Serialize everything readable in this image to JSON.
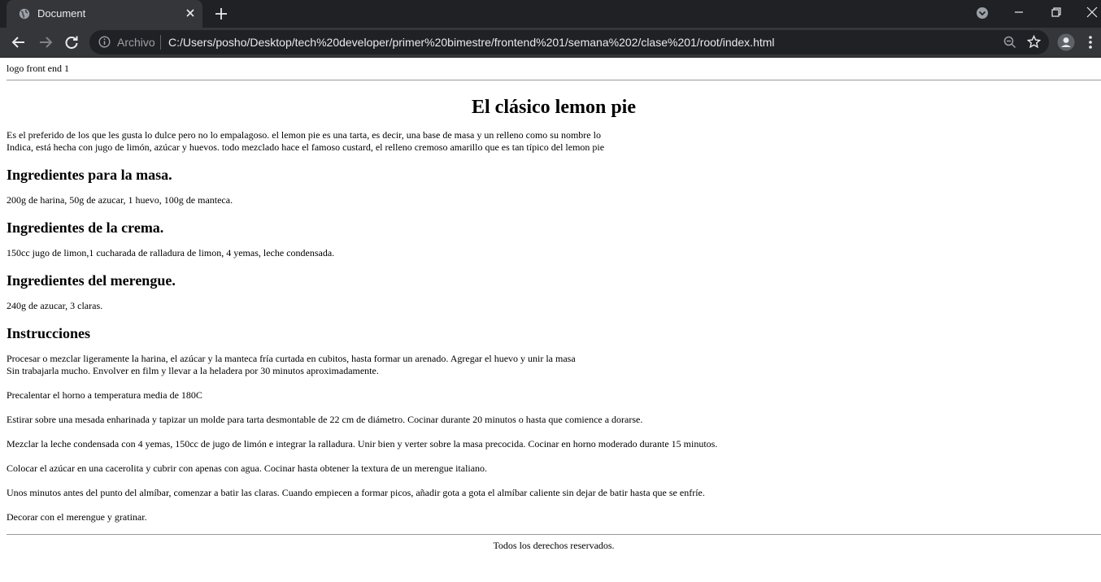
{
  "browser": {
    "tab_title": "Document",
    "url_scheme": "Archivo",
    "url": "C:/Users/posho/Desktop/tech%20developer/primer%20bimestre/frontend%201/semana%202/clase%201/root/index.html"
  },
  "page": {
    "logo_alt": "logo front end 1",
    "title": "El clásico lemon pie",
    "intro_line1": "Es el preferido de los que les gusta lo dulce pero no lo empalagoso. el lemon pie es una tarta, es decir, una base de masa y un relleno como su nombre lo",
    "intro_line2": "Indica, está hecha con jugo de limón, azúcar y huevos. todo mezclado hace el famoso custard, el relleno cremoso amarillo que es tan típico del lemon pie",
    "sections": [
      {
        "heading": "Ingredientes para la masa.",
        "text": "200g de harina, 50g de azucar, 1 huevo, 100g de manteca."
      },
      {
        "heading": "Ingredientes de la crema.",
        "text": "150cc jugo de limon,1 cucharada de ralladura de limon, 4 yemas, leche condensada."
      },
      {
        "heading": "Ingredientes del merengue.",
        "text": "240g de azucar, 3 claras."
      }
    ],
    "instructions_heading": "Instrucciones",
    "instructions": [
      "Procesar o mezclar ligeramente la harina, el azúcar y la manteca fría curtada en cubitos, hasta formar un arenado. Agregar el huevo y unir la masa",
      "Sin trabajarla mucho. Envolver en film y llevar a la heladera por 30 minutos aproximadamente.",
      "Precalentar el horno a temperatura media de 180C",
      "Estirar sobre una mesada enharinada y tapizar un molde para tarta desmontable de 22 cm de diámetro. Cocinar durante 20 minutos o hasta que comience a dorarse.",
      "Mezclar la leche condensada con 4 yemas, 150cc de jugo de limón e integrar la ralladura. Unir bien y verter sobre la masa precocida. Cocinar en horno moderado durante 15 minutos.",
      "Colocar el azúcar en una cacerolita y cubrir con apenas con agua. Cocinar hasta obtener la textura de un merengue italiano.",
      "Unos minutos antes del punto del almíbar, comenzar a batir las claras. Cuando empiecen a formar picos, añadir gota a gota el almíbar caliente sin dejar de batir hasta que se enfríe.",
      "Decorar con el merengue y gratinar."
    ],
    "footer": "Todos los derechos reservados."
  }
}
